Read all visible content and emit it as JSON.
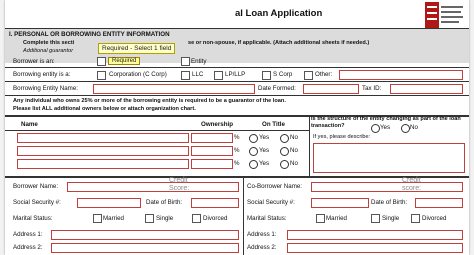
{
  "header": {
    "title": "al Loan Application",
    "logo_name": "bank-logo"
  },
  "section": {
    "heading": "I.    PERSONAL OR BORROWING ENTITY INFORMATION",
    "line1_left": "Complete this secti",
    "line1_right": "se or non-spouse, if applicable. (Attach additional sheets if needed.)",
    "line2": "Additional guarantor"
  },
  "tooltip": {
    "text": "Required - Select 1 field",
    "required": "Required"
  },
  "borrower_is": {
    "label": "Borrower is an:",
    "entity_label": "Entity"
  },
  "entity_type": {
    "label": "Borrowing entity is a:",
    "options": [
      "Corporation (C Corp)",
      "LLC",
      "LP/LLP",
      "S Corp",
      "Other:"
    ]
  },
  "entity_row": {
    "name_label": "Borrowing Entity Name:",
    "date_label": "Date Formed:",
    "tax_label": "Tax ID:"
  },
  "guarantor_note": {
    "line1": "Any individual who owns 25% or more of the borrowing entity is required to be a guarantor of the loan.",
    "line2": "Please list ALL additional owners below or attach organization chart."
  },
  "owners_table": {
    "col_name": "Name",
    "col_ownership": "Ownership",
    "col_title": "On Title",
    "pct": "%",
    "yes": "Yes",
    "no": "No",
    "structure_q": "Is the structure of the entity changing as part of the loan transaction?",
    "describe": "If yes, please describe:"
  },
  "borrower": {
    "name": "Borrower Name:",
    "ghost": "Credit Score:",
    "ssn": "Social Security #:",
    "dob": "Date of Birth:",
    "marital": "Marital Status:",
    "married": "Married",
    "single": "Single",
    "divorced": "Divorced",
    "addr1": "Address 1:",
    "addr2": "Address 2:"
  },
  "co_borrower": {
    "name": "Co-Borrower Name:",
    "ghost": "Credit score:",
    "ssn": "Social Security #:",
    "dob": "Date of Birth:",
    "marital": "Marital Status:",
    "married": "Married",
    "single": "Single",
    "divorced": "Divorced",
    "addr1": "Address 1:",
    "addr2": "Address 2:"
  },
  "colors": {
    "field_border": "#c04040",
    "section_bg": "#dcdcdc",
    "tooltip_bg": "#ffffcc"
  }
}
